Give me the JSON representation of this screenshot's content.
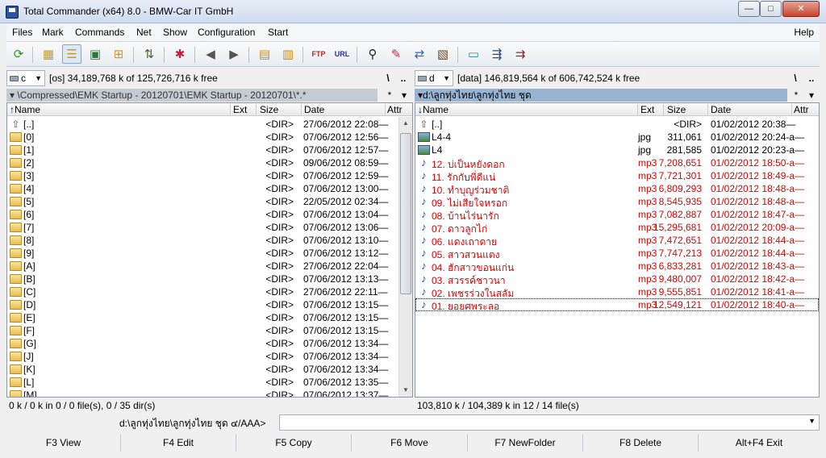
{
  "window": {
    "title": "Total Commander (x64) 8.0 - BMW-Car IT GmbH",
    "min": "—",
    "max": "□",
    "close": "✕"
  },
  "menu": {
    "items": [
      "Files",
      "Mark",
      "Commands",
      "Net",
      "Show",
      "Configuration",
      "Start"
    ],
    "help": "Help"
  },
  "toolbar": {
    "icons": [
      "refresh-icon",
      "icons-view-icon",
      "list-view-icon",
      "thumbnail-view-icon",
      "tree-view-icon",
      "invert-selection-icon",
      "compare-dirs-icon",
      "back-icon",
      "forward-icon",
      "pack-icon",
      "unpack-icon",
      "ftp-icon",
      "url-icon",
      "search-icon",
      "multi-rename-icon",
      "sync-dirs-icon",
      "notepad-icon",
      "calculator-icon",
      "remote-icon",
      "disconnect-icon"
    ]
  },
  "left": {
    "drive": "c",
    "drive_info": "[os]  34,189,768 k of  125,726,716 k free",
    "root_btn": "\\",
    "up_btn": "..",
    "path": "\\Compressed\\EMK Startup - 20120701\\EMK Startup - 20120701\\*.*",
    "star": "*",
    "columns": {
      "name": "↑Name",
      "ext": "Ext",
      "size": "Size",
      "date": "Date",
      "attr": "Attr"
    },
    "rows": [
      {
        "name": "[..]",
        "ext": "",
        "size": "<DIR>",
        "date": "27/06/2012 22:08—",
        "type": "up"
      },
      {
        "name": "[0]",
        "ext": "",
        "size": "<DIR>",
        "date": "07/06/2012 12:56—",
        "type": "dir"
      },
      {
        "name": "[1]",
        "ext": "",
        "size": "<DIR>",
        "date": "07/06/2012 12:57—",
        "type": "dir"
      },
      {
        "name": "[2]",
        "ext": "",
        "size": "<DIR>",
        "date": "09/06/2012 08:59—",
        "type": "dir"
      },
      {
        "name": "[3]",
        "ext": "",
        "size": "<DIR>",
        "date": "07/06/2012 12:59—",
        "type": "dir"
      },
      {
        "name": "[4]",
        "ext": "",
        "size": "<DIR>",
        "date": "07/06/2012 13:00—",
        "type": "dir"
      },
      {
        "name": "[5]",
        "ext": "",
        "size": "<DIR>",
        "date": "22/05/2012 02:34—",
        "type": "dir"
      },
      {
        "name": "[6]",
        "ext": "",
        "size": "<DIR>",
        "date": "07/06/2012 13:04—",
        "type": "dir"
      },
      {
        "name": "[7]",
        "ext": "",
        "size": "<DIR>",
        "date": "07/06/2012 13:06—",
        "type": "dir"
      },
      {
        "name": "[8]",
        "ext": "",
        "size": "<DIR>",
        "date": "07/06/2012 13:10—",
        "type": "dir"
      },
      {
        "name": "[9]",
        "ext": "",
        "size": "<DIR>",
        "date": "07/06/2012 13:12—",
        "type": "dir"
      },
      {
        "name": "[A]",
        "ext": "",
        "size": "<DIR>",
        "date": "27/06/2012 22:04—",
        "type": "dir"
      },
      {
        "name": "[B]",
        "ext": "",
        "size": "<DIR>",
        "date": "07/06/2012 13:13—",
        "type": "dir"
      },
      {
        "name": "[C]",
        "ext": "",
        "size": "<DIR>",
        "date": "27/06/2012 22:11—",
        "type": "dir"
      },
      {
        "name": "[D]",
        "ext": "",
        "size": "<DIR>",
        "date": "07/06/2012 13:15—",
        "type": "dir"
      },
      {
        "name": "[E]",
        "ext": "",
        "size": "<DIR>",
        "date": "07/06/2012 13:15—",
        "type": "dir"
      },
      {
        "name": "[F]",
        "ext": "",
        "size": "<DIR>",
        "date": "07/06/2012 13:15—",
        "type": "dir"
      },
      {
        "name": "[G]",
        "ext": "",
        "size": "<DIR>",
        "date": "07/06/2012 13:34—",
        "type": "dir"
      },
      {
        "name": "[J]",
        "ext": "",
        "size": "<DIR>",
        "date": "07/06/2012 13:34—",
        "type": "dir"
      },
      {
        "name": "[K]",
        "ext": "",
        "size": "<DIR>",
        "date": "07/06/2012 13:34—",
        "type": "dir"
      },
      {
        "name": "[L]",
        "ext": "",
        "size": "<DIR>",
        "date": "07/06/2012 13:35—",
        "type": "dir"
      },
      {
        "name": "[M]",
        "ext": "",
        "size": "<DIR>",
        "date": "07/06/2012 13:37—",
        "type": "dir"
      }
    ],
    "status": "0 k / 0 k in 0 / 0 file(s), 0 / 35 dir(s)"
  },
  "right": {
    "drive": "d",
    "drive_info": "[data]  146,819,564 k of  606,742,524 k free",
    "root_btn": "\\",
    "up_btn": "..",
    "path": "d:\\ลูกทุ่งไทย\\ลูกทุ่งไทย ชุด",
    "star": "*",
    "columns": {
      "name": "↓Name",
      "ext": "Ext",
      "size": "Size",
      "date": "Date",
      "attr": "Attr"
    },
    "rows": [
      {
        "name": "[..]",
        "ext": "",
        "size": "<DIR>",
        "date": "01/02/2012 20:38—",
        "type": "up"
      },
      {
        "name": "L4-4",
        "ext": "jpg",
        "size": "311,061",
        "date": "01/02/2012 20:24-a—",
        "type": "img"
      },
      {
        "name": "L4",
        "ext": "jpg",
        "size": "281,585",
        "date": "01/02/2012 20:23-a—",
        "type": "img"
      },
      {
        "name": "12. บ่เป็นหยังดอก",
        "ext": "mp3",
        "size": "7,208,651",
        "date": "01/02/2012 18:50-a—",
        "type": "mp3"
      },
      {
        "name": "11. รักกับพี่ดีแน่",
        "ext": "mp3",
        "size": "7,721,301",
        "date": "01/02/2012 18:49-a—",
        "type": "mp3"
      },
      {
        "name": "10. ทำบุญร่วมชาติ",
        "ext": "mp3",
        "size": "6,809,293",
        "date": "01/02/2012 18:48-a—",
        "type": "mp3"
      },
      {
        "name": "09. ไม่เสียใจหรอก",
        "ext": "mp3",
        "size": "8,545,935",
        "date": "01/02/2012 18:48-a—",
        "type": "mp3"
      },
      {
        "name": "08. บ้านไร่นารัก",
        "ext": "mp3",
        "size": "7,082,887",
        "date": "01/02/2012 18:47-a—",
        "type": "mp3"
      },
      {
        "name": "07. ดาวลูกไก่",
        "ext": "mp3",
        "size": "15,295,681",
        "date": "01/02/2012 20:09-a—",
        "type": "mp3"
      },
      {
        "name": "06. แดงเถาดาย",
        "ext": "mp3",
        "size": "7,472,651",
        "date": "01/02/2012 18:44-a—",
        "type": "mp3"
      },
      {
        "name": "05. สาวสวนแตง",
        "ext": "mp3",
        "size": "7,747,213",
        "date": "01/02/2012 18:44-a—",
        "type": "mp3"
      },
      {
        "name": "04. ฮักสาวขอนแก่น",
        "ext": "mp3",
        "size": "6,833,281",
        "date": "01/02/2012 18:43-a—",
        "type": "mp3"
      },
      {
        "name": "03. สวรรค์ชาวนา",
        "ext": "mp3",
        "size": "9,480,007",
        "date": "01/02/2012 18:42-a—",
        "type": "mp3"
      },
      {
        "name": "02. เพชรร่วงในสลัม",
        "ext": "mp3",
        "size": "9,555,851",
        "date": "01/02/2012 18:41-a—",
        "type": "mp3"
      },
      {
        "name": "01. ยอยศพระลอ",
        "ext": "mp3",
        "size": "12,549,121",
        "date": "01/02/2012 18:40-a—",
        "type": "mp3"
      }
    ],
    "status": "103,810 k / 104,389 k in 12 / 14 file(s)"
  },
  "cmdline": {
    "label": "d:\\ลูกทุ่งไทย\\ลูกทุ่งไทย ชุด ๔/AAA>",
    "value": ""
  },
  "fkeys": [
    "F3 View",
    "F4 Edit",
    "F5 Copy",
    "F6 Move",
    "F7 NewFolder",
    "F8 Delete",
    "Alt+F4 Exit"
  ],
  "colors": {
    "highlight_file": "#e00000",
    "active_path": "#99b4d1",
    "inactive_path": "#c5cbd3"
  }
}
